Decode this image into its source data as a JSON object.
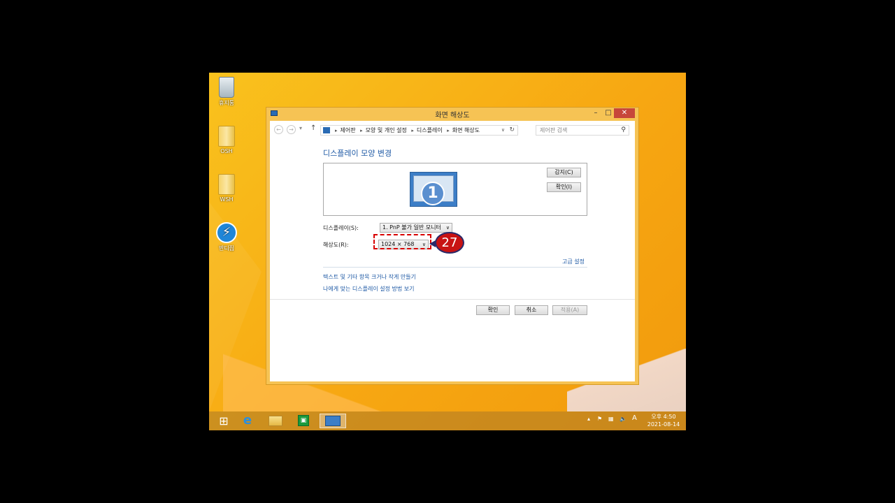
{
  "desktop": {
    "icons": [
      {
        "label": "휴지통"
      },
      {
        "label": "OSH"
      },
      {
        "label": "WSH"
      },
      {
        "label": "반디집"
      }
    ]
  },
  "window": {
    "title": "화면 해상도",
    "address": {
      "crumbs": [
        "제어판",
        "모양 및 개인 설정",
        "디스플레이",
        "화면 해상도"
      ],
      "search_placeholder": "제어판 검색"
    },
    "heading": "디스플레이 모양 변경",
    "monitor_number": "1",
    "detect_button": "감지(C)",
    "identify_button": "확인(I)",
    "display_label": "디스플레이(S):",
    "display_value": "1. PnP 불가 일반 모니터",
    "resolution_label": "해상도(R):",
    "resolution_value": "1024 × 768",
    "annotation_number": "27",
    "advanced_link": "고급 설정",
    "text_size_link": "텍스트 및 기타 항목 크거나 작게 만들기",
    "help_link": "나에게 맞는 디스플레이 설정 방법 보기",
    "ok_button": "확인",
    "cancel_button": "취소",
    "apply_button": "적용(A)"
  },
  "taskbar": {
    "clock_time": "오후 4:50",
    "clock_date": "2021-08-14",
    "ime": "A"
  }
}
